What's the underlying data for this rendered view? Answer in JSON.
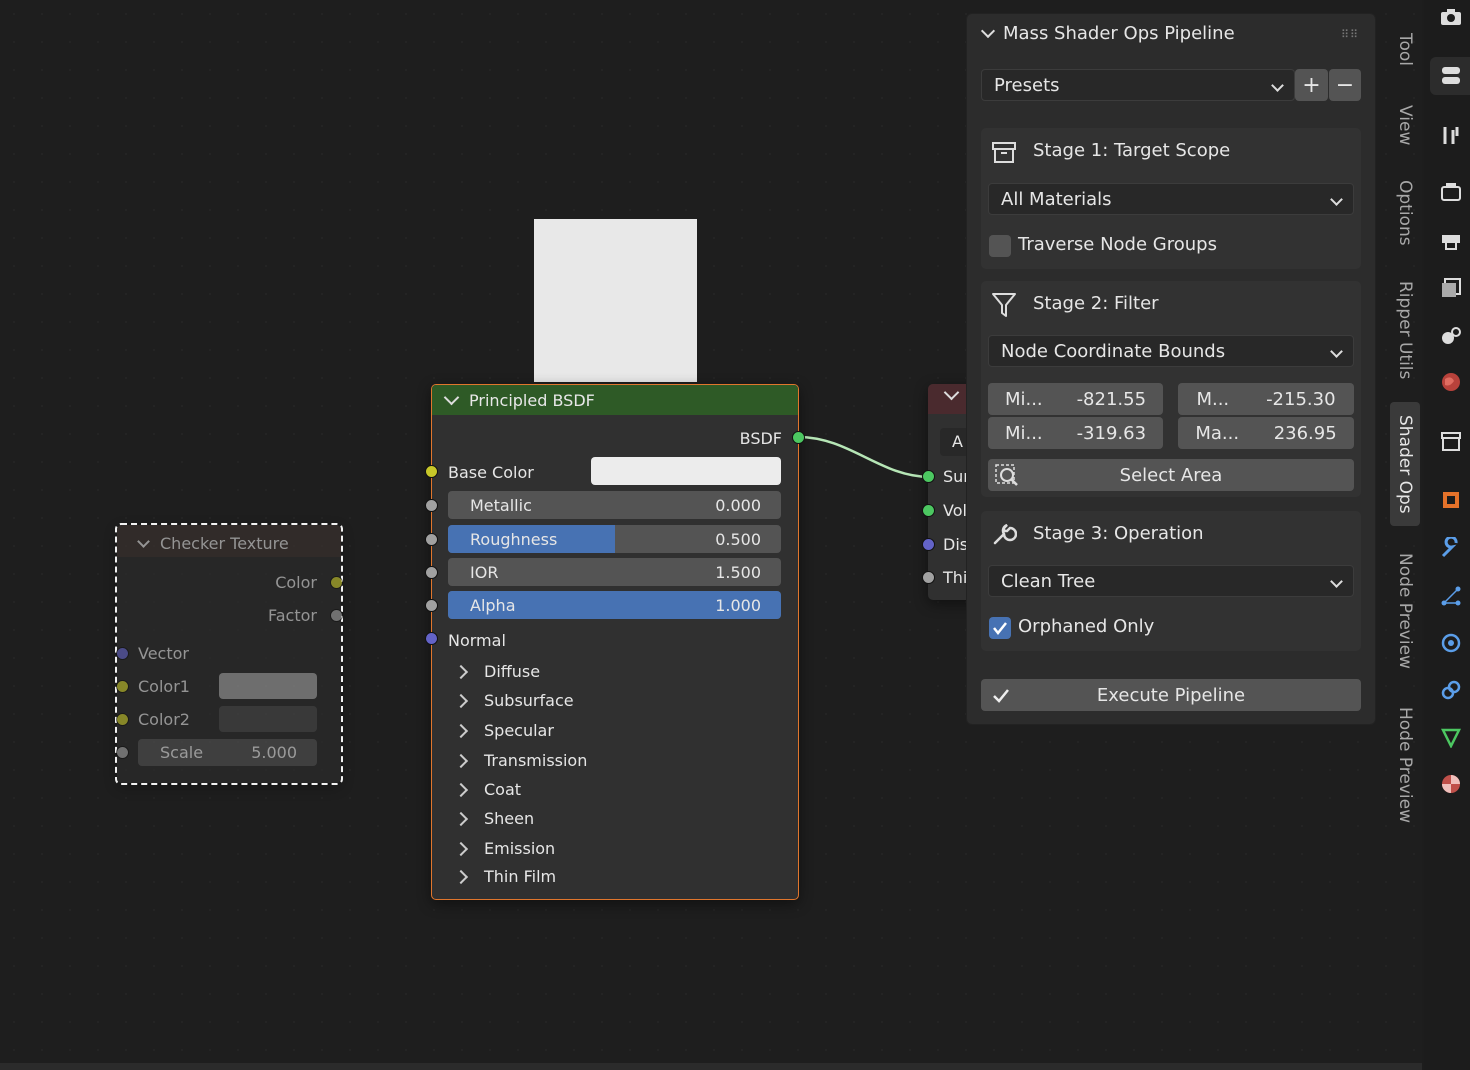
{
  "node_editor": {
    "principled": {
      "title": "Principled BSDF",
      "output": "BSDF",
      "base_color_label": "Base Color",
      "fields": [
        {
          "label": "Metallic",
          "value": "0.000",
          "fill": 0.0
        },
        {
          "label": "Roughness",
          "value": "0.500",
          "fill": 0.5
        },
        {
          "label": "IOR",
          "value": "1.500",
          "fill": 0.0
        },
        {
          "label": "Alpha",
          "value": "1.000",
          "fill": 1.0
        }
      ],
      "normal_label": "Normal",
      "panels": [
        "Diffuse",
        "Subsurface",
        "Specular",
        "Transmission",
        "Coat",
        "Sheen",
        "Emission",
        "Thin Film"
      ]
    },
    "checker": {
      "title": "Checker Texture",
      "outputs": [
        "Color",
        "Factor"
      ],
      "vector_label": "Vector",
      "color1_label": "Color1",
      "color2_label": "Color2",
      "scale_label": "Scale",
      "scale_value": "5.000"
    },
    "output_node": {
      "header_field": "A",
      "inputs": [
        "Sur",
        "Vol",
        "Dis",
        "Thi"
      ]
    }
  },
  "npanel": {
    "title": "Mass Shader Ops Pipeline",
    "presets_label": "Presets",
    "add_symbol": "+",
    "remove_symbol": "−",
    "stage1": {
      "title": "Stage 1: Target Scope",
      "scope_value": "All Materials",
      "traverse_label": "Traverse Node Groups",
      "traverse_checked": false
    },
    "stage2": {
      "title": "Stage 2: Filter",
      "filter_value": "Node Coordinate Bounds",
      "bounds": [
        {
          "label": "Mi...",
          "value": "-821.55"
        },
        {
          "label": "M...",
          "value": "-215.30"
        },
        {
          "label": "Mi...",
          "value": "-319.63"
        },
        {
          "label": "Ma...",
          "value": "236.95"
        }
      ],
      "select_area_label": "Select Area"
    },
    "stage3": {
      "title": "Stage 3: Operation",
      "operation_value": "Clean Tree",
      "orphaned_label": "Orphaned Only",
      "orphaned_checked": true
    },
    "execute_label": "Execute Pipeline"
  },
  "side_tabs": [
    "Tool",
    "View",
    "Options",
    "Ripper Utils",
    "Shader Ops",
    "Node Preview",
    "Hode Preview"
  ],
  "active_tab": "Shader Ops",
  "icons": [
    "camera-icon",
    "toggle-icon",
    "tool-settings-icon",
    "render-icon",
    "output-icon",
    "view-layer-icon",
    "scene-icon",
    "world-icon",
    "collection-icon",
    "object-icon",
    "modifier-icon",
    "particles-icon",
    "physics-icon",
    "constraints-icon",
    "data-icon",
    "material-icon"
  ],
  "colors": {
    "accent": "#4772b3",
    "node_header": "#2e5a26",
    "active_outline": "#e0762d",
    "link": "#b6e6b6"
  }
}
